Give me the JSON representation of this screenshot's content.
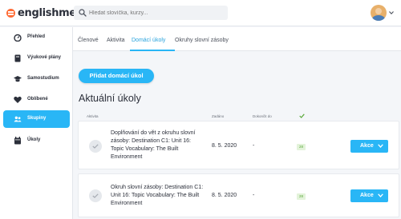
{
  "header": {
    "logo_text": "englishme!",
    "search_placeholder": "Hledat slovíčka, kurzy..."
  },
  "sidebar": {
    "items": [
      {
        "label": "Přehled",
        "icon": "dashboard-icon"
      },
      {
        "label": "Výukové plány",
        "icon": "book-icon"
      },
      {
        "label": "Samostudium",
        "icon": "graduation-cap-icon"
      },
      {
        "label": "Oblíbené",
        "icon": "heart-icon"
      },
      {
        "label": "Skupiny",
        "icon": "group-icon",
        "active": true
      },
      {
        "label": "Úkoly",
        "icon": "calendar-icon"
      }
    ]
  },
  "tabs": [
    {
      "label": "Členové"
    },
    {
      "label": "Aktivita"
    },
    {
      "label": "Domácí úkoly",
      "active": true
    },
    {
      "label": "Okruhy slovní zásoby"
    }
  ],
  "main": {
    "add_button_label": "Přidat domácí úkol",
    "section_title": "Aktuální úkoly",
    "columns": {
      "activity": "Aktivita",
      "assigned": "Zadáno",
      "due": "Dokončit do"
    },
    "tasks": [
      {
        "title": "Doplňování do vět z okruhu slovní zásoby: Destination C1: Unit 16: Topic Vocabulary: The Built Environment",
        "assigned": "8. 5. 2020",
        "due": "-",
        "badge": "28",
        "action_label": "Akce"
      },
      {
        "title": "Okruh slovní zásoby: Destination C1: Unit 16: Topic Vocabulary: The Built Environment",
        "assigned": "8. 5. 2020",
        "due": "-",
        "badge": "28",
        "action_label": "Akce"
      }
    ]
  },
  "colors": {
    "accent": "#29b6f6",
    "logo_orange": "#ff6b35",
    "badge_green": "#5aa83a"
  }
}
